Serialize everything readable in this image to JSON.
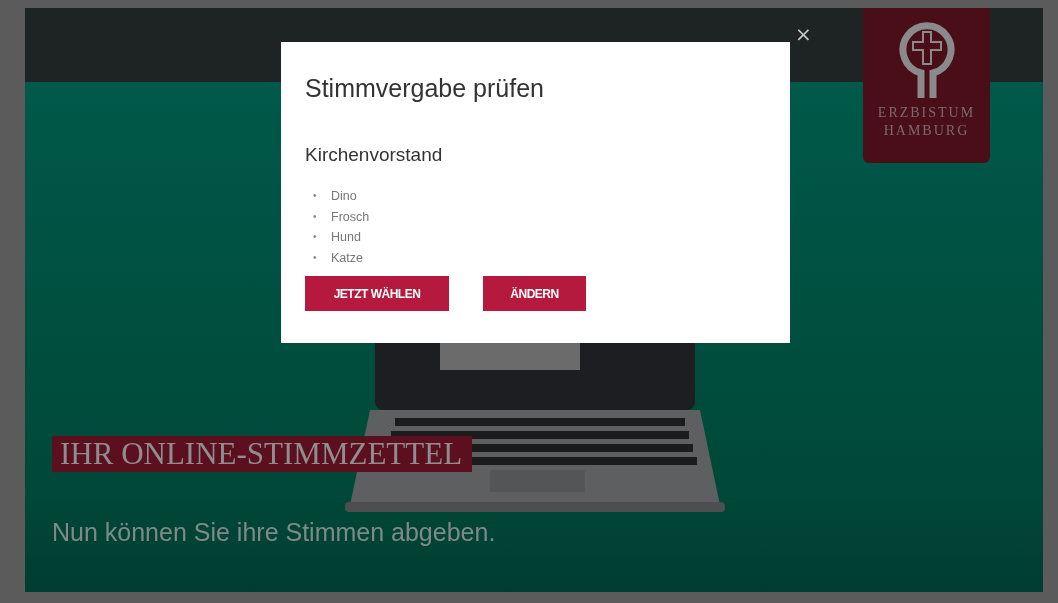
{
  "header": {
    "logo": {
      "lines": [
        "ERZBISTUM",
        "HAMBURG"
      ]
    }
  },
  "hero": {
    "title": "IHR ONLINE-STIMMZETTEL",
    "subtitle": "Nun können Sie ihre Stimmen abgeben."
  },
  "dialog": {
    "close": "×",
    "title": "Stimmvergabe prüfen",
    "section": "Kirchenvorstand",
    "candidates": [
      {
        "bullet": "•",
        "name": "Dino"
      },
      {
        "bullet": "•",
        "name": "Frosch"
      },
      {
        "bullet": "•",
        "name": "Hund"
      },
      {
        "bullet": "•",
        "name": "Katze"
      }
    ],
    "buttons": [
      {
        "label": "JETZT WÄHLEN"
      },
      {
        "label": "ÄNDERN"
      }
    ]
  }
}
